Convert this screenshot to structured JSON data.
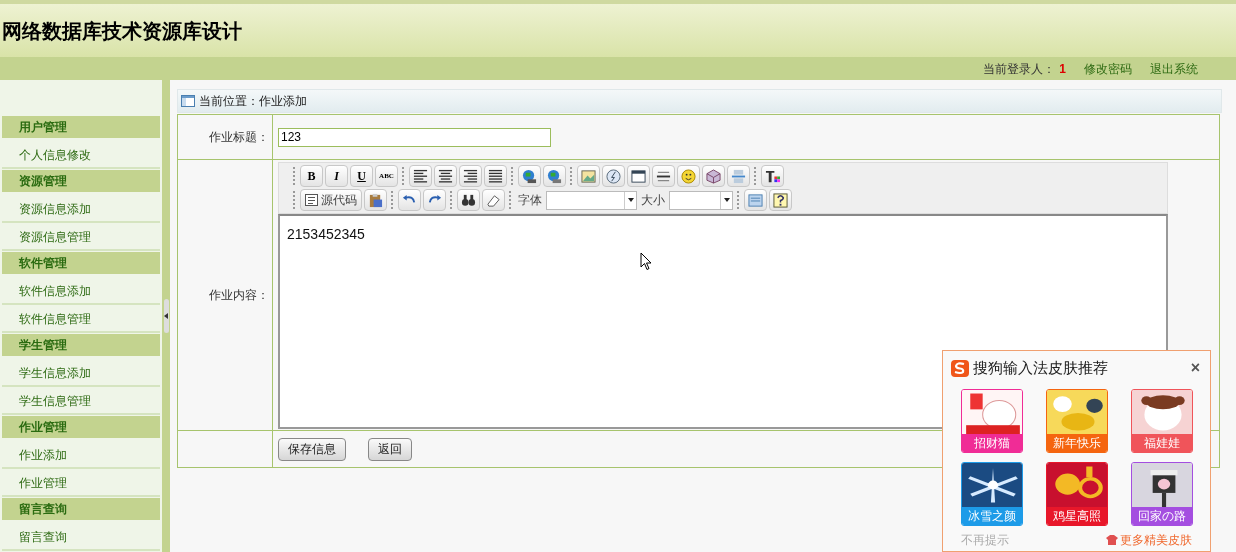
{
  "header": {
    "title": "网络数据库技术资源库设计"
  },
  "top_bar": {
    "login_label": "当前登录人：",
    "login_user": "1",
    "links": [
      "修改密码",
      "退出系统"
    ]
  },
  "sidebar": {
    "groups": [
      {
        "title": "用户管理",
        "items": [
          {
            "label": "个人信息修改",
            "selected": false
          }
        ]
      },
      {
        "title": "资源管理",
        "items": [
          {
            "label": "资源信息添加",
            "selected": false
          },
          {
            "label": "资源信息管理",
            "selected": false
          }
        ]
      },
      {
        "title": "软件管理",
        "items": [
          {
            "label": "软件信息添加",
            "selected": false
          },
          {
            "label": "软件信息管理",
            "selected": false
          }
        ]
      },
      {
        "title": "学生管理",
        "items": [
          {
            "label": "学生信息添加",
            "selected": false
          },
          {
            "label": "学生信息管理",
            "selected": false
          }
        ]
      },
      {
        "title": "作业管理",
        "items": [
          {
            "label": "作业添加",
            "selected": false
          },
          {
            "label": "作业管理",
            "selected": false
          }
        ]
      },
      {
        "title": "留言查询",
        "items": [
          {
            "label": "留言查询",
            "selected": false
          }
        ]
      }
    ]
  },
  "breadcrumb": "当前位置：作业添加",
  "form": {
    "title_label": "作业标题：",
    "title_value": "123",
    "content_label": "作业内容：",
    "content_value": "2153452345",
    "toolbar": {
      "format_buttons": [
        "B",
        "I",
        "U",
        "ABC"
      ],
      "source_button": "源代码",
      "font_label": "字体",
      "size_label": "大小"
    },
    "buttons": [
      "保存信息",
      "返回"
    ]
  },
  "skin_popup": {
    "title": "搜狗输入法皮肤推荐",
    "close": "×",
    "skins": [
      {
        "label": "招财猫",
        "color": "#f02c96"
      },
      {
        "label": "新年快乐",
        "color": "#f5650f"
      },
      {
        "label": "福娃娃",
        "color": "#f0545a"
      },
      {
        "label": "冰雪之颜",
        "color": "#1d9be8"
      },
      {
        "label": "鸡星高照",
        "color": "#e8172a"
      },
      {
        "label": "回家の路",
        "color": "#a44ee0"
      }
    ],
    "dismiss": "不再提示",
    "more": "更多精美皮肤"
  }
}
